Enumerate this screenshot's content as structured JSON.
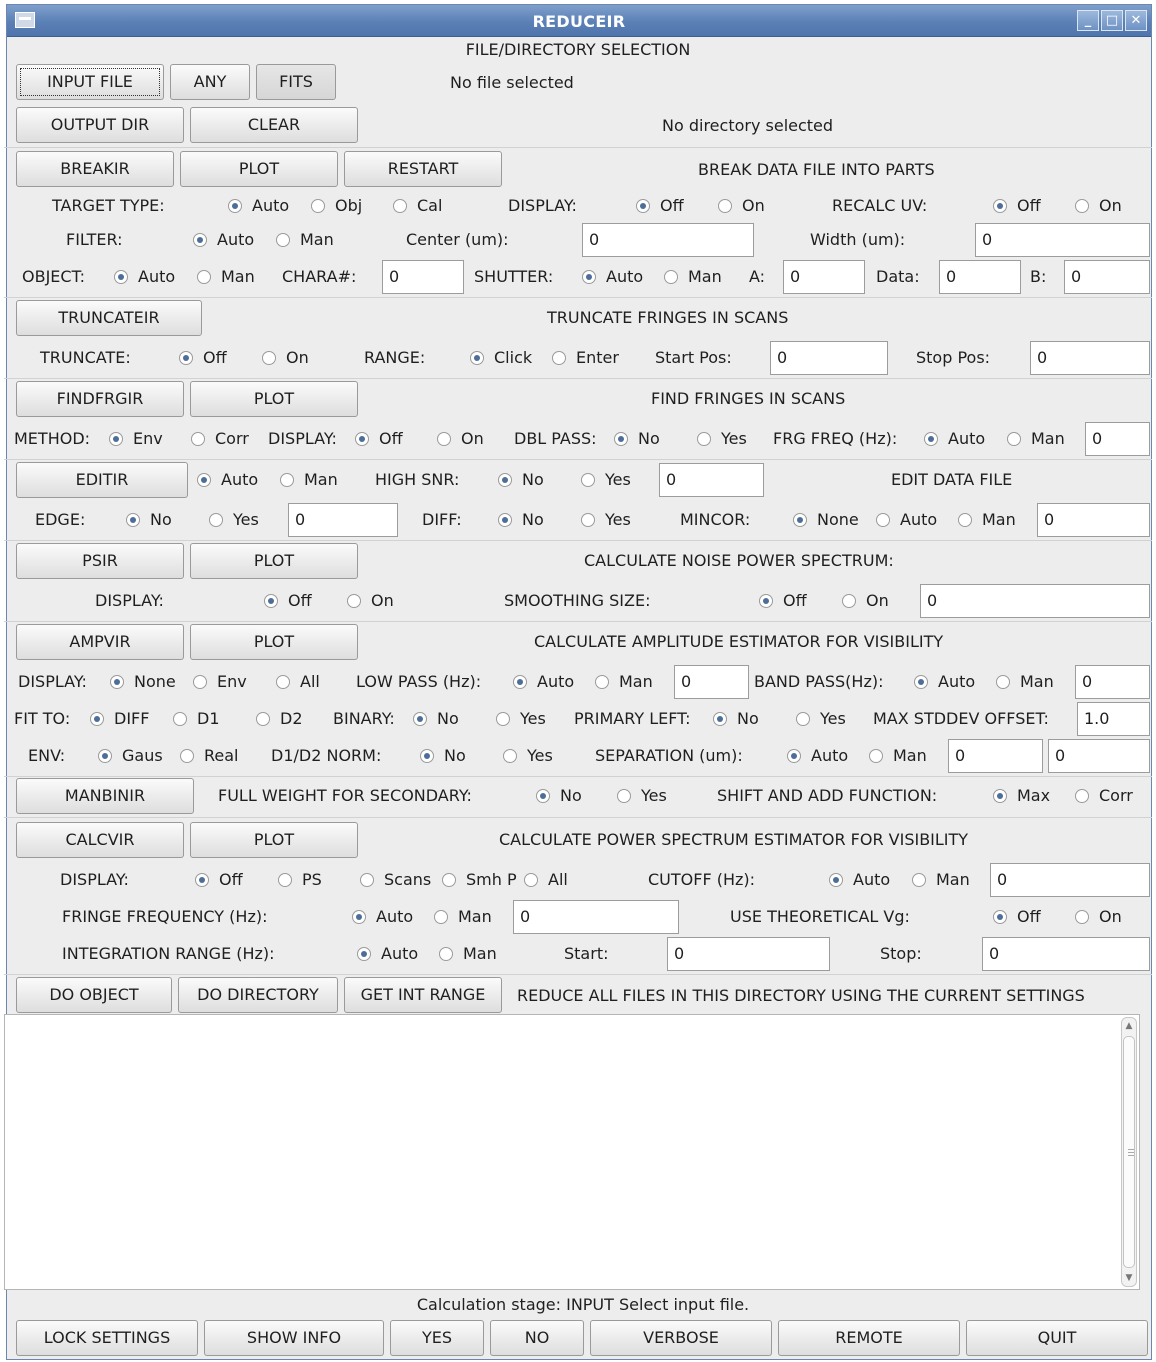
{
  "window": {
    "title": "REDUCEIR"
  },
  "file_section": {
    "header": "FILE/DIRECTORY SELECTION",
    "input_file": "INPUT FILE",
    "any": "ANY",
    "fits": "FITS",
    "file_status": "No file selected",
    "output_dir": "OUTPUT DIR",
    "clear": "CLEAR",
    "dir_status": "No directory selected"
  },
  "breakir": {
    "button": "BREAKIR",
    "plot": "PLOT",
    "restart": "RESTART",
    "title": "BREAK DATA FILE INTO PARTS",
    "target_type": "TARGET TYPE:",
    "tt_auto": "Auto",
    "tt_obj": "Obj",
    "tt_cal": "Cal",
    "display": "DISPLAY:",
    "d_off": "Off",
    "d_on": "On",
    "recalc": "RECALC UV:",
    "r_off": "Off",
    "r_on": "On",
    "filter": "FILTER:",
    "f_auto": "Auto",
    "f_man": "Man",
    "center": "Center (um):",
    "center_val": "0",
    "width": "Width (um):",
    "width_val": "0",
    "object": "OBJECT:",
    "o_auto": "Auto",
    "o_man": "Man",
    "chara": "CHARA#:",
    "chara_val": "0",
    "shutter": "SHUTTER:",
    "s_auto": "Auto",
    "s_man": "Man",
    "a": "A:",
    "a_val": "0",
    "data": "Data:",
    "data_val": "0",
    "b": "B:",
    "b_val": "0"
  },
  "truncateir": {
    "button": "TRUNCATEIR",
    "title": "TRUNCATE FRINGES IN SCANS",
    "truncate": "TRUNCATE:",
    "off": "Off",
    "on": "On",
    "range": "RANGE:",
    "click": "Click",
    "enter": "Enter",
    "start": "Start Pos:",
    "start_val": "0",
    "stop": "Stop Pos:",
    "stop_val": "0"
  },
  "findfrgir": {
    "button": "FINDFRGIR",
    "plot": "PLOT",
    "title": "FIND FRINGES IN SCANS",
    "method": "METHOD:",
    "env": "Env",
    "corr": "Corr",
    "display": "DISPLAY:",
    "off": "Off",
    "on": "On",
    "dbl": "DBL PASS:",
    "no": "No",
    "yes": "Yes",
    "frg": "FRG FREQ (Hz):",
    "auto": "Auto",
    "man": "Man",
    "frg_val": "0"
  },
  "editir": {
    "button": "EDITIR",
    "auto": "Auto",
    "man": "Man",
    "snr": "HIGH SNR:",
    "no": "No",
    "yes": "Yes",
    "snr_val": "0",
    "title": "EDIT DATA FILE",
    "edge": "EDGE:",
    "e_no": "No",
    "e_yes": "Yes",
    "edge_val": "0",
    "diff": "DIFF:",
    "d_no": "No",
    "d_yes": "Yes",
    "mincor": "MINCOR:",
    "none": "None",
    "m_auto": "Auto",
    "m_man": "Man",
    "mincor_val": "0"
  },
  "psir": {
    "button": "PSIR",
    "plot": "PLOT",
    "title": "CALCULATE NOISE POWER SPECTRUM:",
    "display": "DISPLAY:",
    "off": "Off",
    "on": "On",
    "smooth": "SMOOTHING SIZE:",
    "s_off": "Off",
    "s_on": "On",
    "smooth_val": "0"
  },
  "ampvir": {
    "button": "AMPVIR",
    "plot": "PLOT",
    "title": "CALCULATE AMPLITUDE ESTIMATOR FOR VISIBILITY",
    "display": "DISPLAY:",
    "none": "None",
    "env": "Env",
    "all": "All",
    "lowpass": "LOW PASS (Hz):",
    "lp_auto": "Auto",
    "lp_man": "Man",
    "lp_val": "0",
    "bandpass": "BAND PASS(Hz):",
    "bp_auto": "Auto",
    "bp_man": "Man",
    "bp_val": "0",
    "fit": "FIT TO:",
    "f_diff": "DIFF",
    "f_d1": "D1",
    "f_d2": "D2",
    "binary": "BINARY:",
    "b_no": "No",
    "b_yes": "Yes",
    "primary": "PRIMARY LEFT:",
    "p_no": "No",
    "p_yes": "Yes",
    "maxstd": "MAX STDDEV OFFSET:",
    "maxstd_val": "1.0",
    "envl": "ENV:",
    "gaus": "Gaus",
    "real": "Real",
    "norm": "D1/D2 NORM:",
    "n_no": "No",
    "n_yes": "Yes",
    "sep": "SEPARATION (um):",
    "sep_auto": "Auto",
    "sep_man": "Man",
    "sep_val1": "0",
    "sep_val2": "0"
  },
  "manbinir": {
    "button": "MANBINIR",
    "fullw": "FULL WEIGHT FOR SECONDARY:",
    "no": "No",
    "yes": "Yes",
    "shift": "SHIFT AND ADD FUNCTION:",
    "max": "Max",
    "corr": "Corr"
  },
  "calcvir": {
    "button": "CALCVIR",
    "plot": "PLOT",
    "title": "CALCULATE POWER SPECTRUM ESTIMATOR FOR VISIBILITY",
    "display": "DISPLAY:",
    "off": "Off",
    "ps": "PS",
    "scans": "Scans",
    "smh": "Smh P",
    "all": "All",
    "cutoff": "CUTOFF (Hz):",
    "c_auto": "Auto",
    "c_man": "Man",
    "cutoff_val": "0",
    "fringe": "FRINGE FREQUENCY (Hz):",
    "fr_auto": "Auto",
    "fr_man": "Man",
    "fringe_val": "0",
    "theo": "USE THEORETICAL Vg:",
    "t_off": "Off",
    "t_on": "On",
    "intr": "INTEGRATION RANGE (Hz):",
    "i_auto": "Auto",
    "i_man": "Man",
    "start": "Start:",
    "start_val": "0",
    "stop": "Stop:",
    "stop_val": "0"
  },
  "actions": {
    "do_object": "DO OBJECT",
    "do_directory": "DO DIRECTORY",
    "get_int_range": "GET INT RANGE",
    "desc": "REDUCE ALL FILES IN THIS DIRECTORY USING THE CURRENT SETTINGS"
  },
  "log": {
    "text": ""
  },
  "status": "Calculation stage: INPUT Select input file.",
  "bottom": {
    "lock": "LOCK SETTINGS",
    "info": "SHOW INFO",
    "yes": "YES",
    "no": "NO",
    "verbose": "VERBOSE",
    "remote": "REMOTE",
    "quit": "QUIT"
  }
}
